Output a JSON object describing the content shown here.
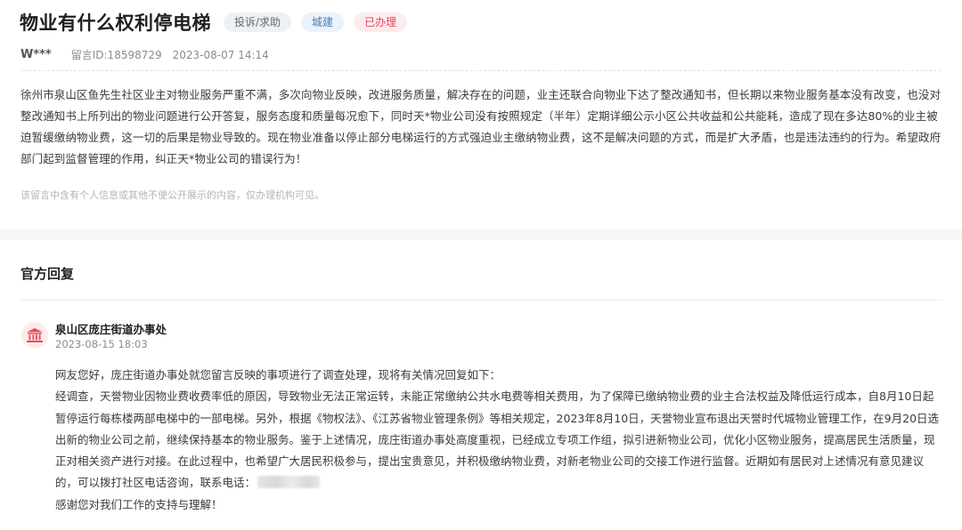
{
  "message": {
    "title": "物业有什么权利停电梯",
    "tags": {
      "type": "投诉/求助",
      "field": "城建",
      "status": "已办理"
    },
    "author": "W***",
    "message_id": "留言ID:18598729",
    "datetime": "2023-08-07 14:14",
    "body": "徐州市泉山区鱼先生社区业主对物业服务严重不满，多次向物业反映，改进服务质量，解决存在的问题，业主还联合向物业下达了整改通知书，但长期以来物业服务基本没有改变，也没对整改通知书上所列出的物业问题进行公开答复，服务态度和质量每况愈下，同时天*物业公司没有按照规定（半年）定期详细公示小区公共收益和公共能耗，造成了现在多达80%的业主被迫暂缓缴纳物业费，这一切的后果是物业导致的。现在物业准备以停止部分电梯运行的方式强迫业主缴纳物业费，这不是解决问题的方式，而是扩大矛盾，也是违法违约的行为。希望政府部门起到监督管理的作用，纠正天*物业公司的错误行为！",
    "privacy_note": "该留言中含有个人信息或其他不便公开展示的内容，仅办理机构可见。"
  },
  "reply_section": {
    "heading": "官方回复",
    "avatar_icon": "government-building-icon",
    "org_name": "泉山区庞庄街道办事处",
    "datetime": "2023-08-15 18:03",
    "greeting": "网友您好，庞庄街道办事处就您留言反映的事项进行了调查处理，现将有关情况回复如下：",
    "body": "经调查，天誉物业因物业费收费率低的原因，导致物业无法正常运转，未能正常缴纳公共水电费等相关费用，为了保障已缴纳物业费的业主合法权益及降低运行成本，自8月10日起暂停运行每栋楼两部电梯中的一部电梯。另外，根据《物权法》、《江苏省物业管理条例》等相关规定，2023年8月10日，天誉物业宣布退出天誉时代城物业管理工作，在9月20日选出新的物业公司之前，继续保持基本的物业服务。鉴于上述情况，庞庄街道办事处高度重视，已经成立专项工作组，拟引进新物业公司，优化小区物业服务，提高居民生活质量，现正对相关资产进行对接。在此过程中，也希望广大居民积极参与，提出宝贵意见，并积极缴纳物业费，对新老物业公司的交接工作进行监督。近期如有居民对上述情况有意见建议的，可以拨打社区电话咨询，联系电话：",
    "closing": "感谢您对我们工作的支持与理解！"
  },
  "colors": {
    "tag_type_bg": "#eef0f4",
    "tag_field_bg": "#eaf2fb",
    "tag_status_bg": "#fdecef",
    "tag_status_text": "#e0485e",
    "avatar_bg": "#fdeced",
    "avatar_icon": "#e3505f"
  }
}
